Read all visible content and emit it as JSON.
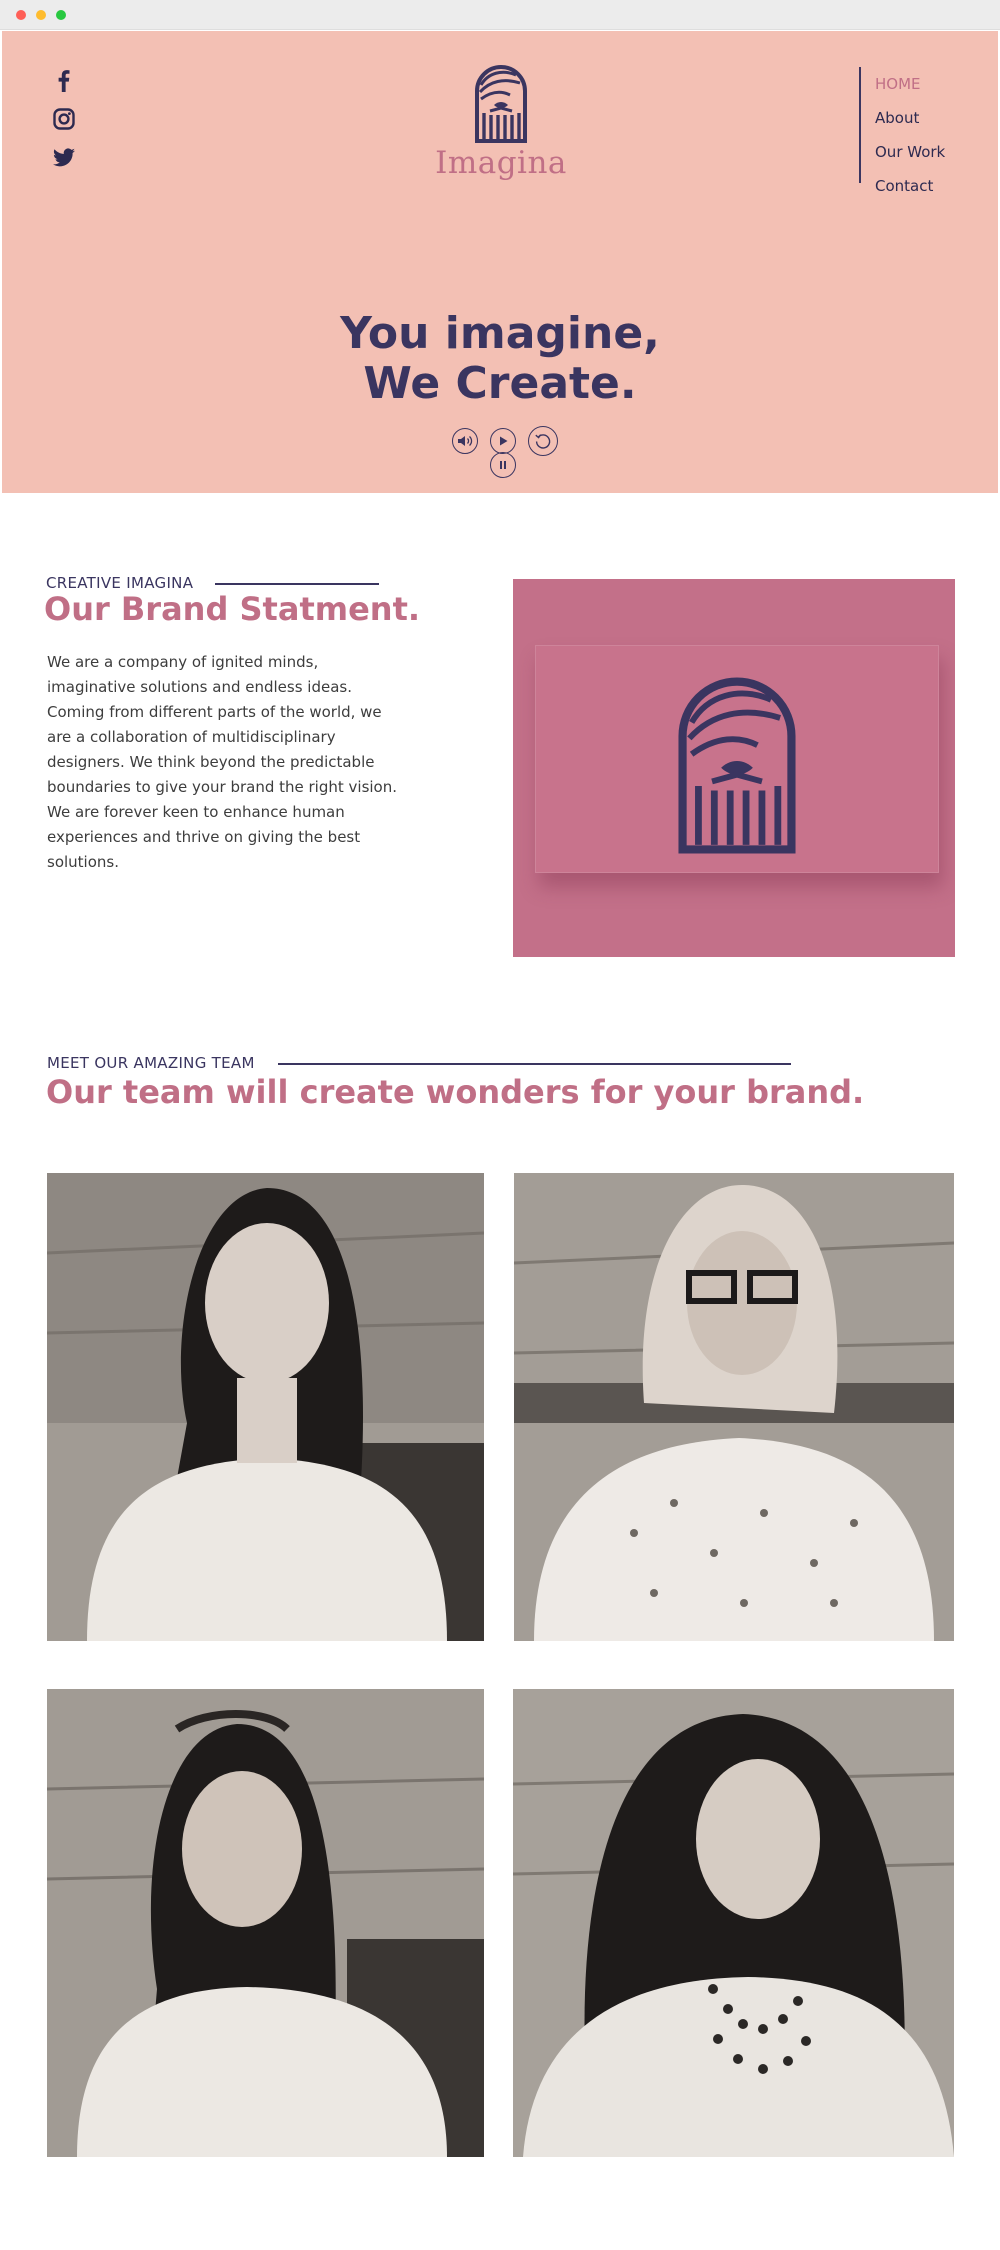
{
  "window": {
    "buttons": [
      "close",
      "minimize",
      "zoom"
    ]
  },
  "colors": {
    "hero_bg": "#f3c0b4",
    "accent": "#c06f86",
    "ink": "#3a3560",
    "brand_image_bg": "#c37089"
  },
  "header": {
    "social": [
      {
        "name": "facebook",
        "icon": "facebook-icon"
      },
      {
        "name": "instagram",
        "icon": "instagram-icon"
      },
      {
        "name": "twitter",
        "icon": "twitter-icon"
      }
    ],
    "logo_text": "Imagina",
    "nav": [
      {
        "label": "HOME",
        "active": true
      },
      {
        "label": "About",
        "active": false
      },
      {
        "label": "Our Work",
        "active": false
      },
      {
        "label": "Contact",
        "active": false
      }
    ]
  },
  "hero": {
    "title_line1": "You imagine,",
    "title_line2": "We Create.",
    "controls": [
      {
        "name": "sound",
        "icon": "speaker-icon"
      },
      {
        "name": "play",
        "icon": "play-icon"
      },
      {
        "name": "replay",
        "icon": "replay-icon"
      },
      {
        "name": "pause",
        "icon": "pause-icon"
      }
    ]
  },
  "brand": {
    "eyebrow": "CREATIVE IMAGINA",
    "title": "Our Brand Statment.",
    "body": "We are a company of ignited minds, imaginative solutions and endless ideas. Coming from different parts of the world, we are a collaboration of multidisciplinary designers. We think beyond the predictable boundaries to give your brand the right vision. We are forever keen to enhance human experiences and thrive on giving the best solutions."
  },
  "team": {
    "eyebrow": "MEET OUR AMAZING TEAM",
    "title": "Our team will create wonders for your brand.",
    "members_shown": 4
  }
}
